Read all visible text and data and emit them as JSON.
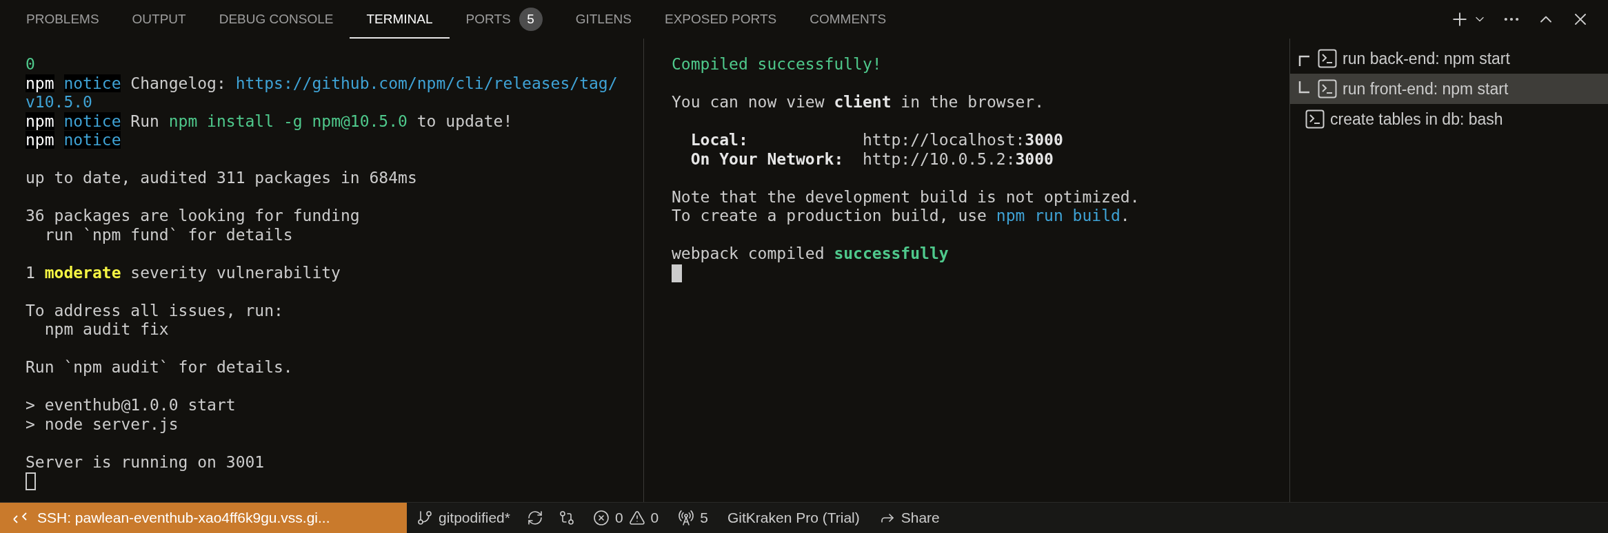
{
  "panel_tabs": [
    {
      "label": "PROBLEMS",
      "selected": false
    },
    {
      "label": "OUTPUT",
      "selected": false
    },
    {
      "label": "DEBUG CONSOLE",
      "selected": false
    },
    {
      "label": "TERMINAL",
      "selected": true
    },
    {
      "label": "PORTS",
      "selected": false,
      "badge": "5"
    },
    {
      "label": "GITLENS",
      "selected": false
    },
    {
      "label": "EXPOSED PORTS",
      "selected": false
    },
    {
      "label": "COMMENTS",
      "selected": false
    }
  ],
  "terminals": [
    {
      "focused": false,
      "lines": [
        {
          "kind": "text",
          "segments": [
            {
              "text": "0",
              "kind": "green"
            }
          ]
        },
        {
          "kind": "text",
          "segments": [
            {
              "text": "npm",
              "kind": "npm"
            },
            {
              "text": " notice",
              "kind": "notice"
            },
            {
              "text": " Changelog: ",
              "kind": "plain"
            },
            {
              "text": "https://github.com/npm/cli/releases/tag/",
              "kind": "blue"
            }
          ]
        },
        {
          "kind": "text",
          "segments": [
            {
              "text": "v10.5.0",
              "kind": "blue"
            }
          ]
        },
        {
          "kind": "text",
          "segments": [
            {
              "text": "npm",
              "kind": "npm"
            },
            {
              "text": " notice",
              "kind": "notice"
            },
            {
              "text": " Run ",
              "kind": "plain"
            },
            {
              "text": "npm install -g npm@10.5.0",
              "kind": "green"
            },
            {
              "text": " to update!",
              "kind": "plain"
            }
          ]
        },
        {
          "kind": "text",
          "segments": [
            {
              "text": "npm",
              "kind": "npm"
            },
            {
              "text": " notice",
              "kind": "notice"
            }
          ]
        },
        {
          "kind": "blank"
        },
        {
          "kind": "text",
          "segments": [
            {
              "text": "up to date, audited 311 packages in 684ms",
              "kind": "plain"
            }
          ]
        },
        {
          "kind": "blank"
        },
        {
          "kind": "text",
          "segments": [
            {
              "text": "36 packages are looking for funding",
              "kind": "plain"
            }
          ]
        },
        {
          "kind": "text",
          "segments": [
            {
              "text": "  run `npm fund` for details",
              "kind": "plain"
            }
          ]
        },
        {
          "kind": "blank"
        },
        {
          "kind": "text",
          "segments": [
            {
              "text": "1 ",
              "kind": "plain"
            },
            {
              "text": "moderate",
              "kind": "yellow"
            },
            {
              "text": " severity vulnerability",
              "kind": "plain"
            }
          ]
        },
        {
          "kind": "blank"
        },
        {
          "kind": "text",
          "segments": [
            {
              "text": "To address all issues, run:",
              "kind": "plain"
            }
          ]
        },
        {
          "kind": "text",
          "segments": [
            {
              "text": "  npm audit fix",
              "kind": "plain"
            }
          ]
        },
        {
          "kind": "blank"
        },
        {
          "kind": "text",
          "segments": [
            {
              "text": "Run `npm audit` for details.",
              "kind": "plain"
            }
          ]
        },
        {
          "kind": "blank"
        },
        {
          "kind": "text",
          "segments": [
            {
              "text": "> eventhub@1.0.0 start",
              "kind": "plain"
            }
          ]
        },
        {
          "kind": "text",
          "segments": [
            {
              "text": "> node server.js",
              "kind": "plain"
            }
          ]
        },
        {
          "kind": "blank"
        },
        {
          "kind": "text",
          "segments": [
            {
              "text": "Server is running on 3001",
              "kind": "plain"
            }
          ]
        }
      ]
    },
    {
      "focused": true,
      "lines": [
        {
          "kind": "text",
          "segments": [
            {
              "text": "Compiled successfully!",
              "kind": "green"
            }
          ]
        },
        {
          "kind": "blank"
        },
        {
          "kind": "text",
          "segments": [
            {
              "text": "You can now view ",
              "kind": "plain"
            },
            {
              "text": "client",
              "kind": "bold"
            },
            {
              "text": " in the browser.",
              "kind": "plain"
            }
          ]
        },
        {
          "kind": "blank"
        },
        {
          "kind": "text",
          "segments": [
            {
              "text": "  Local:",
              "kind": "bold"
            },
            {
              "text": "            http://localhost:",
              "kind": "plain"
            },
            {
              "text": "3000",
              "kind": "bold"
            }
          ]
        },
        {
          "kind": "text",
          "segments": [
            {
              "text": "  On Your Network:",
              "kind": "bold"
            },
            {
              "text": "  http://10.0.5.2:",
              "kind": "plain"
            },
            {
              "text": "3000",
              "kind": "bold"
            }
          ]
        },
        {
          "kind": "blank"
        },
        {
          "kind": "text",
          "segments": [
            {
              "text": "Note that the development build is not optimized.",
              "kind": "plain"
            }
          ]
        },
        {
          "kind": "text",
          "segments": [
            {
              "text": "To create a production build, use ",
              "kind": "plain"
            },
            {
              "text": "npm run build",
              "kind": "blue"
            },
            {
              "text": ".",
              "kind": "plain"
            }
          ]
        },
        {
          "kind": "blank"
        },
        {
          "kind": "text",
          "segments": [
            {
              "text": "webpack compiled ",
              "kind": "plain"
            },
            {
              "text": "successfully",
              "kind": "greenbold"
            }
          ]
        }
      ]
    }
  ],
  "terminal_list": [
    {
      "label": "run back-end: npm start",
      "kind": "top",
      "selected": false
    },
    {
      "label": "run front-end: npm start",
      "kind": "bottom",
      "selected": true
    },
    {
      "label": "create tables in db: bash",
      "kind": "single",
      "selected": false
    }
  ],
  "status_bar": {
    "remote": "SSH: pawlean-eventhub-xao4ff6k9gu.vss.gi...",
    "branch": "gitpodified*",
    "errors": "0",
    "warnings": "0",
    "ports": "5",
    "account": "GitKraken Pro (Trial)",
    "share": "Share"
  }
}
